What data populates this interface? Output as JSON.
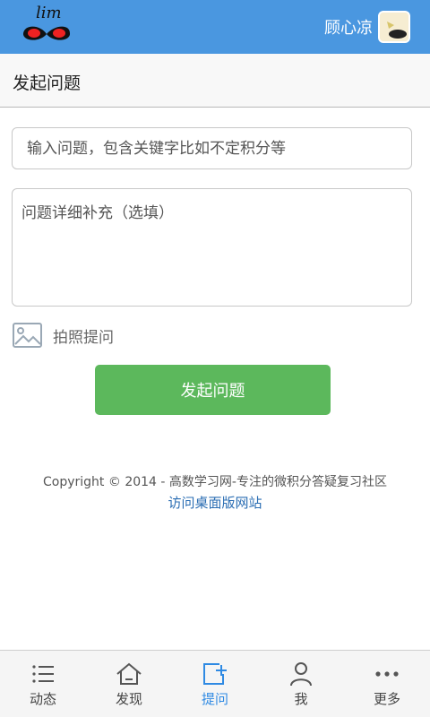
{
  "header": {
    "logo_text": "lim",
    "username": "顾心凉"
  },
  "subheader": {
    "title": "发起问题"
  },
  "form": {
    "question_placeholder": "输入问题，包含关键字比如不定积分等",
    "detail_placeholder": "问题详细补充（选填）",
    "photo_label": "拍照提问",
    "submit_label": "发起问题"
  },
  "footer": {
    "copyright": "Copyright © 2014 - 高数学习网-专注的微积分答疑复习社区",
    "desktop_link": "访问桌面版网站"
  },
  "tabbar": {
    "items": [
      {
        "label": "动态",
        "icon": "list-icon"
      },
      {
        "label": "发现",
        "icon": "home-icon"
      },
      {
        "label": "提问",
        "icon": "ask-icon",
        "active": true
      },
      {
        "label": "我",
        "icon": "person-icon"
      },
      {
        "label": "更多",
        "icon": "more-icon"
      }
    ]
  },
  "colors": {
    "header_bg": "#4a97e0",
    "submit_bg": "#5cb85c",
    "active_tab": "#2f8ae3",
    "link": "#2a6db3"
  }
}
